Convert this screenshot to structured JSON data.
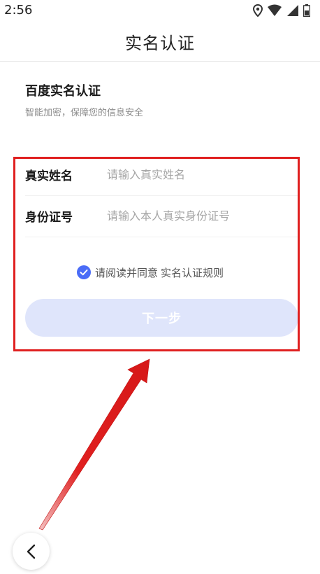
{
  "status_bar": {
    "time": "2:56",
    "icons": [
      "location-icon",
      "wifi-icon",
      "signal-icon",
      "battery-icon"
    ]
  },
  "nav": {
    "title": "实名认证"
  },
  "intro": {
    "title": "百度实名认证",
    "subtitle": "智能加密，保障您的信息安全"
  },
  "form": {
    "name_label": "真实姓名",
    "name_placeholder": "请输入真实姓名",
    "name_value": "",
    "id_label": "身份证号",
    "id_placeholder": "请输入本人真实身份证号",
    "id_value": ""
  },
  "agreement": {
    "checked": true,
    "text": "请阅读并同意",
    "link": "实名认证规则"
  },
  "next_button": {
    "label": "下一步"
  },
  "annotation": {
    "highlight_color": "#e02020"
  },
  "colors": {
    "accent": "#4a6cf7",
    "button_disabled_bg": "#dfe5fb"
  },
  "back_button": {
    "icon": "chevron-left-icon"
  }
}
